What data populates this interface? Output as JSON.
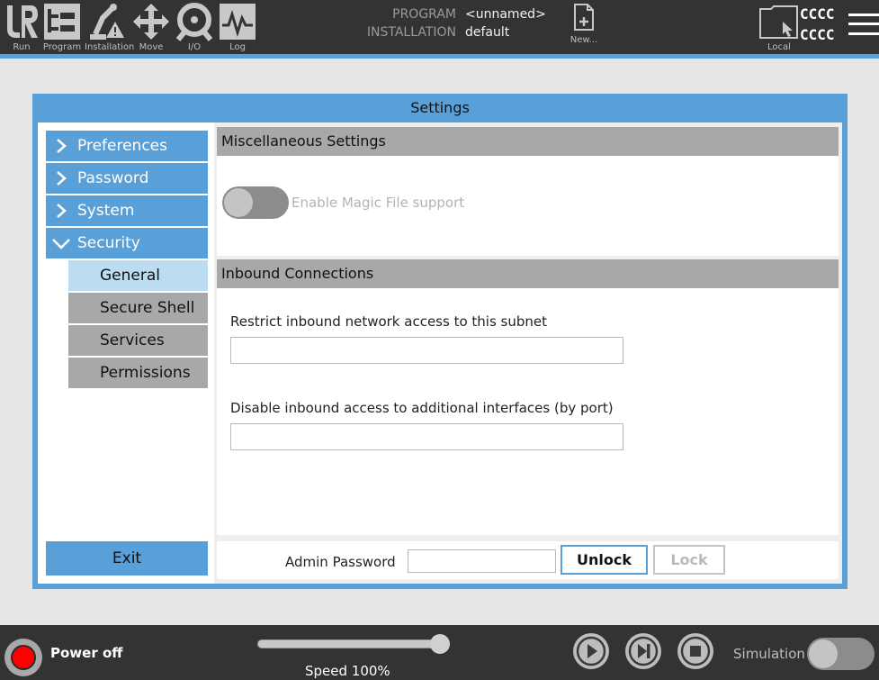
{
  "topbar": {
    "nav": [
      {
        "label": "Run",
        "icon": "ur-logo-icon"
      },
      {
        "label": "Program",
        "icon": "program-icon"
      },
      {
        "label": "Installation",
        "icon": "installation-icon"
      },
      {
        "label": "Move",
        "icon": "move-icon"
      },
      {
        "label": "I/O",
        "icon": "io-icon"
      },
      {
        "label": "Log",
        "icon": "log-icon"
      }
    ],
    "program_key": "PROGRAM",
    "program_value": "<unnamed>",
    "installation_key": "INSTALLATION",
    "installation_value": "default",
    "new_label": "New...",
    "local_label": "Local",
    "robot_id_line1": "CCCC",
    "robot_id_line2": "CCCC"
  },
  "settings": {
    "title": "Settings",
    "sidebar": {
      "items": [
        {
          "label": "Preferences",
          "expanded": false
        },
        {
          "label": "Password",
          "expanded": false
        },
        {
          "label": "System",
          "expanded": false
        },
        {
          "label": "Security",
          "expanded": true
        }
      ],
      "sub_items": [
        {
          "label": "General",
          "active": true
        },
        {
          "label": "Secure Shell",
          "active": false
        },
        {
          "label": "Services",
          "active": false
        },
        {
          "label": "Permissions",
          "active": false
        }
      ],
      "exit_label": "Exit"
    },
    "misc": {
      "header": "Miscellaneous Settings",
      "magic_file_label": "Enable Magic File support",
      "magic_file_enabled": false
    },
    "inbound": {
      "header": "Inbound Connections",
      "subnet_label": "Restrict inbound network access to this subnet",
      "subnet_value": "",
      "ports_label": "Disable inbound access to additional interfaces (by port)",
      "ports_value": ""
    },
    "admin": {
      "password_label": "Admin Password",
      "password_value": "",
      "unlock_label": "Unlock",
      "lock_label": "Lock"
    }
  },
  "bottombar": {
    "power_label": "Power off",
    "speed_label": "Speed 100%",
    "speed_fraction": 1.0,
    "simulation_label": "Simulation",
    "simulation_enabled": false
  },
  "colors": {
    "accent": "#5aa0d8",
    "active_sub": "#bcdcf2",
    "dark_bar": "#333333",
    "power_red": "#ff0000"
  }
}
